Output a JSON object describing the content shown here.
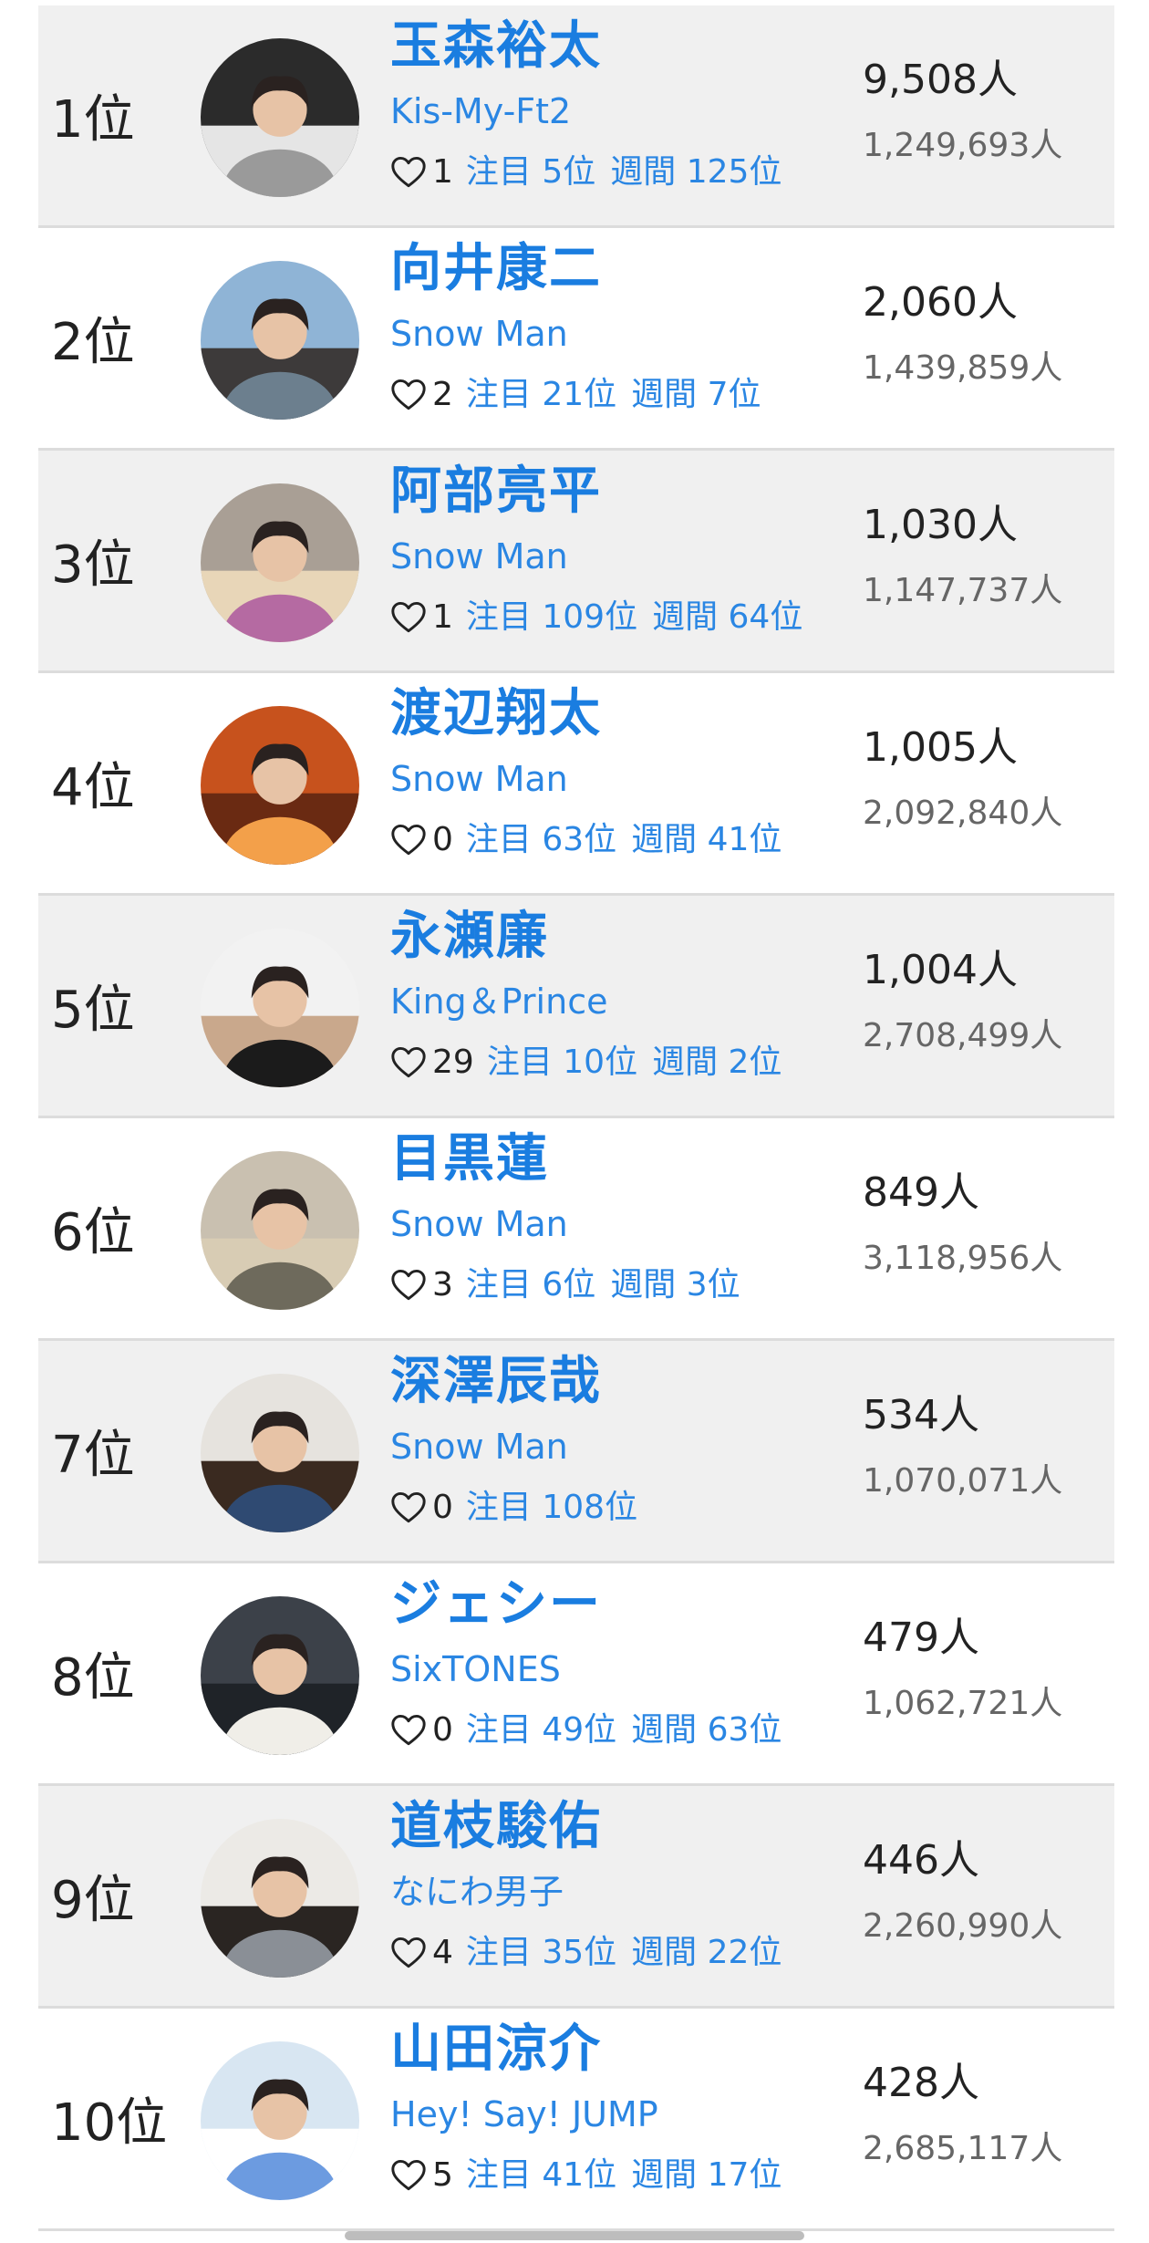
{
  "ranking": [
    {
      "rank": "1位",
      "name": "玉森裕太",
      "group": "Kis-My-Ft2",
      "likes": "1",
      "chumoku": "注目 5位",
      "weekly": "週間 125位",
      "fans": "9,508人",
      "total": "1,249,693人",
      "palette": [
        "#2b2b2b",
        "#9a9a9a",
        "#e5e5e5"
      ]
    },
    {
      "rank": "2位",
      "name": "向井康二",
      "group": "Snow Man",
      "likes": "2",
      "chumoku": "注目 21位",
      "weekly": "週間 7位",
      "fans": "2,060人",
      "total": "1,439,859人",
      "palette": [
        "#8fb4d6",
        "#6c7f8e",
        "#3d3a3a"
      ]
    },
    {
      "rank": "3位",
      "name": "阿部亮平",
      "group": "Snow Man",
      "likes": "1",
      "chumoku": "注目 109位",
      "weekly": "週間 64位",
      "fans": "1,030人",
      "total": "1,147,737人",
      "palette": [
        "#a99f95",
        "#b56aa2",
        "#e8d6b8"
      ]
    },
    {
      "rank": "4位",
      "name": "渡辺翔太",
      "group": "Snow Man",
      "likes": "0",
      "chumoku": "注目 63位",
      "weekly": "週間 41位",
      "fans": "1,005人",
      "total": "2,092,840人",
      "palette": [
        "#c7521d",
        "#f3a04a",
        "#6a2a12"
      ]
    },
    {
      "rank": "5位",
      "name": "永瀬廉",
      "group": "King＆Prince",
      "likes": "29",
      "chumoku": "注目 10位",
      "weekly": "週間 2位",
      "fans": "1,004人",
      "total": "2,708,499人",
      "palette": [
        "#f2f2f2",
        "#1b1b1b",
        "#c9a88c"
      ]
    },
    {
      "rank": "6位",
      "name": "目黒蓮",
      "group": "Snow Man",
      "likes": "3",
      "chumoku": "注目 6位",
      "weekly": "週間 3位",
      "fans": "849人",
      "total": "3,118,956人",
      "palette": [
        "#c9c0b0",
        "#6e6a5c",
        "#d8ccb4"
      ]
    },
    {
      "rank": "7位",
      "name": "深澤辰哉",
      "group": "Snow Man",
      "likes": "0",
      "chumoku": "注目 108位",
      "weekly": "",
      "fans": "534人",
      "total": "1,070,071人",
      "palette": [
        "#e6e3de",
        "#2f4a72",
        "#3a2a20"
      ]
    },
    {
      "rank": "8位",
      "name": "ジェシー",
      "group": "SixTONES",
      "likes": "0",
      "chumoku": "注目 49位",
      "weekly": "週間 63位",
      "fans": "479人",
      "total": "1,062,721人",
      "palette": [
        "#3c4149",
        "#f0eee8",
        "#1f2328"
      ]
    },
    {
      "rank": "9位",
      "name": "道枝駿佑",
      "group": "なにわ男子",
      "likes": "4",
      "chumoku": "注目 35位",
      "weekly": "週間 22位",
      "fans": "446人",
      "total": "2,260,990人",
      "palette": [
        "#eceae6",
        "#8a8f96",
        "#2a2522"
      ]
    },
    {
      "rank": "10位",
      "name": "山田涼介",
      "group": "Hey! Say! JUMP",
      "likes": "5",
      "chumoku": "注目 41位",
      "weekly": "週間 17位",
      "fans": "428人",
      "total": "2,685,117人",
      "palette": [
        "#d8e6f2",
        "#6c9be0",
        "#ffffff"
      ]
    }
  ]
}
